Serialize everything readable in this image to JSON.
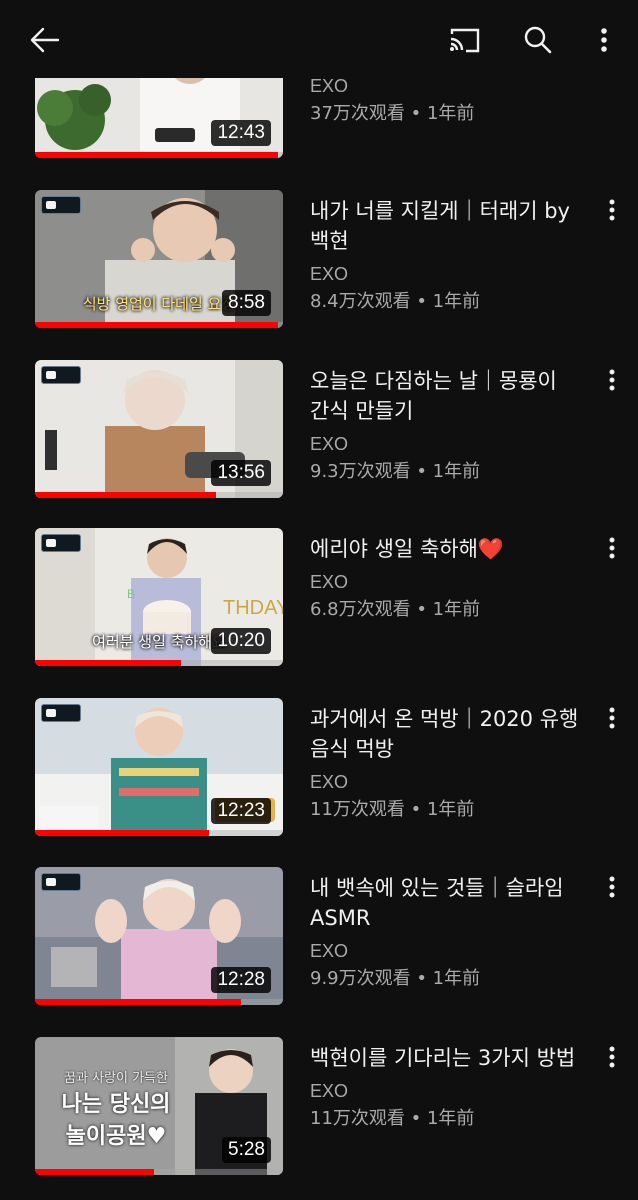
{
  "top_bar": {
    "back_icon": "arrow-left-icon",
    "cast_icon": "cast-icon",
    "search_icon": "search-icon",
    "more_icon": "more-vertical-icon"
  },
  "videos": [
    {
      "title": "",
      "channel": "EXO",
      "stats": "37万次观看 • 1年前",
      "duration": "12:43",
      "progress": 0.98,
      "caption": ""
    },
    {
      "title": "내가 너를 지킬게｜터래기 by 백현",
      "channel": "EXO",
      "stats": "8.4万次观看 • 1年前",
      "duration": "8:58",
      "progress": 0.98,
      "caption": "식방 영업이 다데일 요정"
    },
    {
      "title": "오늘은 다짐하는 날｜몽룡이 간식 만들기",
      "channel": "EXO",
      "stats": "9.3万次观看 • 1年前",
      "duration": "13:56",
      "progress": 0.73,
      "caption": ""
    },
    {
      "title": "에리야 생일 축하해❤️",
      "channel": "EXO",
      "stats": "6.8万次观看 • 1年前",
      "duration": "10:20",
      "progress": 0.59,
      "caption": "여러분 생일 축하해요"
    },
    {
      "title": "과거에서 온 먹방｜2020 유행 음식 먹방",
      "channel": "EXO",
      "stats": "11万次观看 • 1年前",
      "duration": "12:23",
      "progress": 0.7,
      "caption": ""
    },
    {
      "title": "내 뱃속에 있는 것들｜슬라임 ASMR",
      "channel": "EXO",
      "stats": "9.9万次观看 • 1年前",
      "duration": "12:28",
      "progress": 0.83,
      "caption": ""
    },
    {
      "title": "백현이를 기다리는 3가지 방법",
      "channel": "EXO",
      "stats": "11万次观看 • 1年前",
      "duration": "5:28",
      "progress": 0.48,
      "caption": ""
    }
  ],
  "thumb_overlay_7": {
    "line1": "꿈과 사랑이 가득한",
    "line2": "나는 당신의",
    "line3": "놀이공원♥"
  },
  "colors": {
    "background": "#0f0f0f",
    "progress": "#ff0000",
    "secondary_text": "#aaaaaa"
  }
}
